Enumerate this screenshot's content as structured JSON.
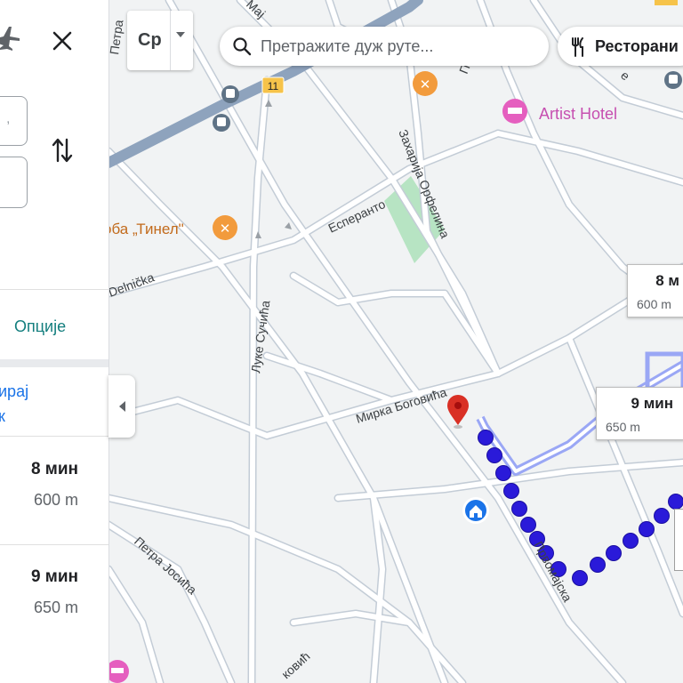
{
  "map": {
    "streets": [
      {
        "id": "esperanto",
        "label": "Есперанто"
      },
      {
        "id": "zaharija",
        "label": "Захарија Орфелина"
      },
      {
        "id": "delnicka",
        "label": "Delnička"
      },
      {
        "id": "luke",
        "label": "Луке Сучића"
      },
      {
        "id": "mirka",
        "label": "Мирка Боговића"
      },
      {
        "id": "petra-josica",
        "label": "Петра Јосића"
      },
      {
        "id": "prvomajska",
        "label": "Првомајска"
      },
      {
        "id": "petra-top",
        "label": "Петра"
      },
      {
        "id": "kovic",
        "label": "ковић"
      },
      {
        "id": "maj-top",
        "label": "Мај"
      },
      {
        "id": "pa-top",
        "label": "Па"
      },
      {
        "id": "e-top",
        "label": "е"
      }
    ],
    "pois": {
      "artist_hotel": "Artist Hotel",
      "restaurant_tinel": "оба „Тинел\"",
      "route_badge": "11"
    },
    "colors": {
      "road": "#ffffff",
      "road_casing": "#c6cfd9",
      "major_road": "#8ea3bd",
      "park": "#b7e4c3",
      "route_dot": "#2a1ad9",
      "route_alt": "#9aa7f5",
      "restaurant": "#f29b3d",
      "hotel": "#e55fbf",
      "pin": "#d93025",
      "home": "#1a73e8"
    }
  },
  "panel": {
    "options_label": "Опције",
    "partial_top": "ирај",
    "partial_bottom": "к",
    "routes": [
      {
        "time": "8 мин",
        "distance": "600 m"
      },
      {
        "time": "9 мин",
        "distance": "650 m"
      }
    ]
  },
  "toolbar": {
    "layer_label": "Ср",
    "search_placeholder": "Претражите дуж руте...",
    "chip_label": "Ресторани"
  },
  "callouts": [
    {
      "time": "8 м",
      "distance": "600 m"
    },
    {
      "time": "9 мин",
      "distance": "650 m"
    }
  ]
}
